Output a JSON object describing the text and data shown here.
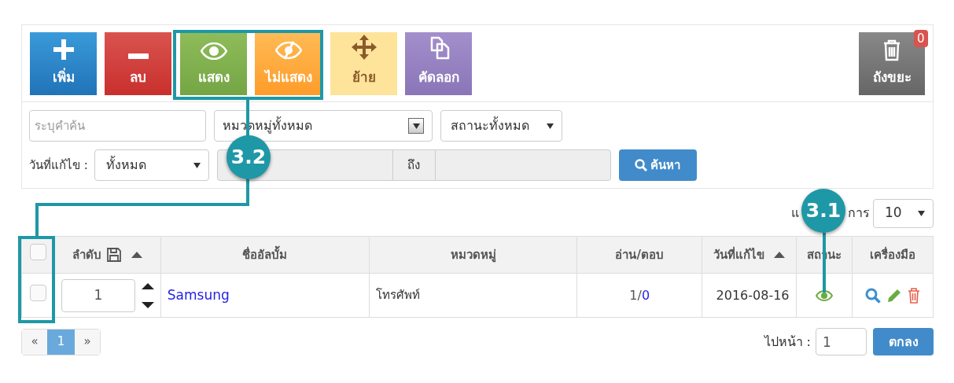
{
  "toolbar": {
    "buttons": [
      {
        "kind": "add",
        "label": "เพิ่ม"
      },
      {
        "kind": "remove",
        "label": "ลบ"
      },
      {
        "kind": "show",
        "label": "แสดง"
      },
      {
        "kind": "hide",
        "label": "ไม่แสดง"
      },
      {
        "kind": "move",
        "label": "ย้าย"
      },
      {
        "kind": "copy",
        "label": "คัดลอก"
      }
    ],
    "trash": {
      "label": "ถังขยะ",
      "count": "0"
    }
  },
  "filters": {
    "search": {
      "placeholder": "ระบุคำค้น"
    },
    "category": {
      "value": "หมวดหมู่ทั้งหมด"
    },
    "status": {
      "value": "สถานะทั้งหมด"
    },
    "date_label": "วันที่แก้ไข :",
    "date_range": {
      "value": "ทั้งหมด"
    },
    "date_to": "ถึง",
    "search_button": "ค้นหา"
  },
  "per_page": {
    "label_start": "แ",
    "label_end": "การ",
    "value": "10"
  },
  "table": {
    "select_all": {
      "checked": false
    },
    "columns": [
      {
        "label": "ลำดับ",
        "kind": "order",
        "sorted": true
      },
      {
        "label": "ชื่ออัลบั้ม",
        "kind": "text",
        "sorted": false
      },
      {
        "label": "หมวดหมู่",
        "kind": "text",
        "sorted": false
      },
      {
        "label": "อ่าน/ตอบ",
        "kind": "text",
        "sorted": false
      },
      {
        "label": "วันที่แก้ไข",
        "kind": "text",
        "sorted": true
      },
      {
        "label": "สถานะ",
        "kind": "text",
        "sorted": false
      },
      {
        "label": "เครื่องมือ",
        "kind": "text",
        "sorted": false
      }
    ],
    "rows": [
      {
        "checked": false,
        "order": "1",
        "name": "Samsung",
        "category": "โทรศัพท์",
        "read": "1/",
        "reply": "0",
        "date": "2016-08-16",
        "visible": true
      }
    ]
  },
  "pagination": {
    "prev": "«",
    "pages": [
      {
        "label": "1",
        "selected": true
      }
    ],
    "next": "»"
  },
  "goto": {
    "label": "ไปหน้า :",
    "value": "1",
    "button": "ตกลง"
  },
  "annotations": [
    {
      "label": "3.2"
    },
    {
      "label": "3.1"
    }
  ]
}
